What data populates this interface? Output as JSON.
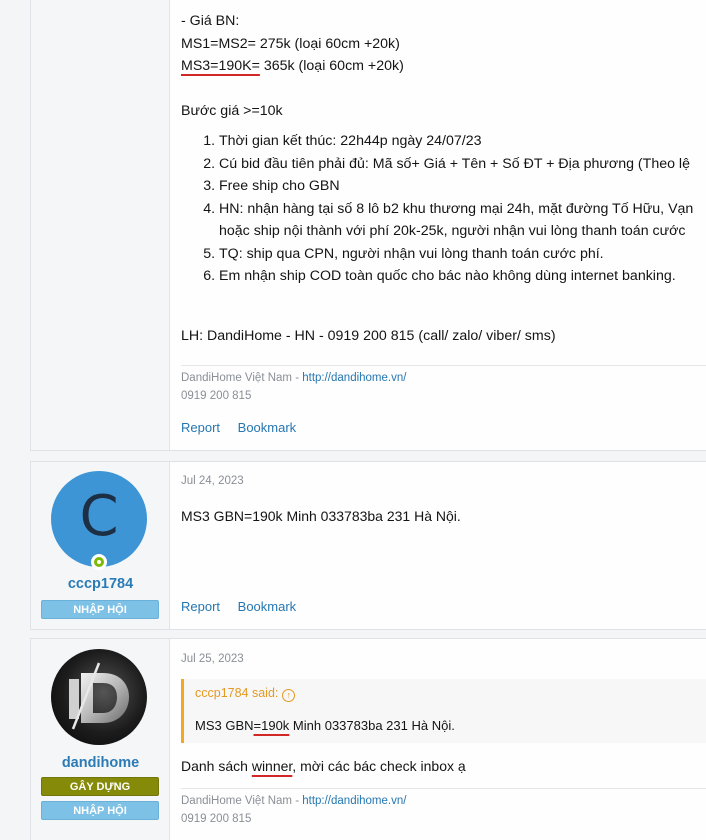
{
  "post1": {
    "lines": [
      "- Giá BN:",
      "MS1=MS2= 275k (loại 60cm +20k)"
    ],
    "ms3_underlined": "MS3=190K=",
    "ms3_rest": " 365k (loại 60cm +20k)",
    "bid_step": "Bước giá >=10k",
    "rules": [
      "Thời gian kết thúc: 22h44p ngày 24/07/23",
      "Cú bid đầu tiên phải đủ: Mã số+ Giá + Tên + Số ĐT + Địa phương (Theo lệ",
      "Free ship cho GBN",
      "HN: nhận hàng tại số 8 lô b2 khu thương mại 24h, mặt đường Tố Hữu, Vạn",
      "TQ: ship qua CPN, người nhận vui lòng thanh toán cước phí.",
      "Em nhận ship COD toàn quốc cho bác nào không dùng internet banking."
    ],
    "rule4_continuation": "hoặc ship nội thành với phí 20k-25k, người nhận vui lòng thanh toán cước",
    "contact": "LH: DandiHome - HN - 0919 200 815 (call/ zalo/ viber/ sms)",
    "signature_name": "DandiHome Việt Nam - ",
    "signature_link": "http://dandihome.vn/",
    "signature_phone": "0919 200 815",
    "report_label": "Report",
    "bookmark_label": "Bookmark"
  },
  "post2": {
    "avatar_letter": "C",
    "username": "cccp1784",
    "badge": "NHẬP HỘI",
    "date": "Jul 24, 2023",
    "text": "MS3 GBN=190k Minh 033783ba 231 Hà Nội.",
    "report_label": "Report",
    "bookmark_label": "Bookmark"
  },
  "post3": {
    "username": "dandihome",
    "badge_primary": "GÂY DỰNG",
    "badge_secondary": "NHẬP HỘI",
    "date": "Jul 25, 2023",
    "quote_author": "cccp1784 said:",
    "quote_pre": "MS3 GBN",
    "quote_underlined": "=190k",
    "quote_post": " Minh 033783ba 231 Hà Nội.",
    "text_pre": "Danh sách ",
    "text_underlined": "winner",
    "text_post": ", mời các bác check inbox ạ",
    "signature_name": "DandiHome Việt Nam - ",
    "signature_link": "http://dandihome.vn/",
    "signature_phone": "0919 200 815"
  },
  "colors": {
    "link": "#2577b1",
    "username": "#2b7bb5",
    "badge_blue": "#7ec1e7",
    "badge_olive": "#868a09",
    "quote_accent": "#f5a623",
    "online": "#7fb900"
  },
  "icons": [
    "online-status-icon",
    "quote-jump-icon"
  ]
}
